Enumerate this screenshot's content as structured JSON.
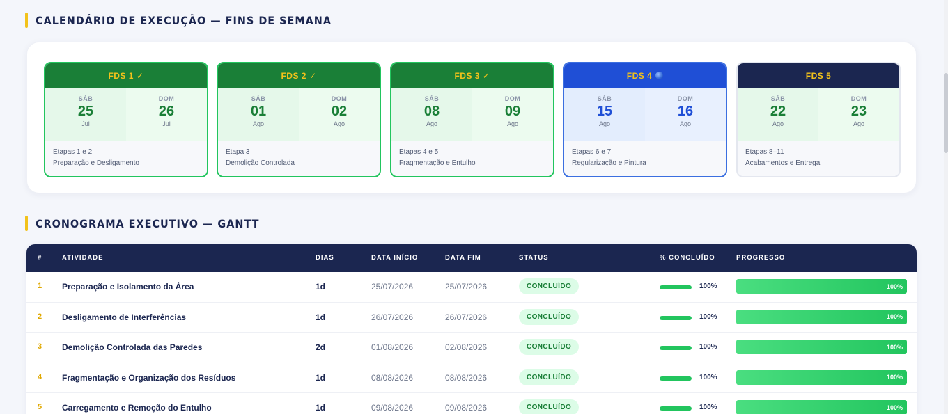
{
  "calendar_section": {
    "title": "CALENDÁRIO DE EXECUÇÃO — FINS DE SEMANA"
  },
  "weekends": [
    {
      "label": "FDS 1",
      "mark": "✓",
      "state": "done",
      "sat": {
        "name": "SÁB",
        "day": "25",
        "month": "Jul"
      },
      "sun": {
        "name": "DOM",
        "day": "26",
        "month": "Jul"
      },
      "steps": "Etapas 1 e 2",
      "desc": "Preparação e Desligamento"
    },
    {
      "label": "FDS 2",
      "mark": "✓",
      "state": "done",
      "sat": {
        "name": "SÁB",
        "day": "01",
        "month": "Ago"
      },
      "sun": {
        "name": "DOM",
        "day": "02",
        "month": "Ago"
      },
      "steps": "Etapa 3",
      "desc": "Demolição Controlada"
    },
    {
      "label": "FDS 3",
      "mark": "✓",
      "state": "done",
      "sat": {
        "name": "SÁB",
        "day": "08",
        "month": "Ago"
      },
      "sun": {
        "name": "DOM",
        "day": "09",
        "month": "Ago"
      },
      "steps": "Etapas 4 e 5",
      "desc": "Fragmentação e Entulho"
    },
    {
      "label": "FDS 4",
      "mark": "",
      "state": "current",
      "sat": {
        "name": "SÁB",
        "day": "15",
        "month": "Ago"
      },
      "sun": {
        "name": "DOM",
        "day": "16",
        "month": "Ago"
      },
      "steps": "Etapas 6 e 7",
      "desc": "Regularização e Pintura"
    },
    {
      "label": "FDS 5",
      "mark": "",
      "state": "upcoming",
      "sat": {
        "name": "SÁB",
        "day": "22",
        "month": "Ago"
      },
      "sun": {
        "name": "DOM",
        "day": "23",
        "month": "Ago"
      },
      "steps": "Etapas 8–11",
      "desc": "Acabamentos e Entrega"
    }
  ],
  "gantt_section": {
    "title": "CRONOGRAMA EXECUTIVO — GANTT"
  },
  "gantt": {
    "columns": {
      "num": "#",
      "activity": "ATIVIDADE",
      "days": "DIAS",
      "start": "DATA INÍCIO",
      "end": "DATA FIM",
      "status": "STATUS",
      "pct": "% CONCLUÍDO",
      "progress": "PROGRESSO"
    },
    "rows": [
      {
        "num": "1",
        "activity": "Preparação e Isolamento da Área",
        "days": "1d",
        "start": "25/07/2026",
        "end": "25/07/2026",
        "status": "CONCLUÍDO",
        "pct_label": "100%",
        "progress": 1.0
      },
      {
        "num": "2",
        "activity": "Desligamento de Interferências",
        "days": "1d",
        "start": "26/07/2026",
        "end": "26/07/2026",
        "status": "CONCLUÍDO",
        "pct_label": "100%",
        "progress": 1.0
      },
      {
        "num": "3",
        "activity": "Demolição Controlada das Paredes",
        "days": "2d",
        "start": "01/08/2026",
        "end": "02/08/2026",
        "status": "CONCLUÍDO",
        "pct_label": "100%",
        "progress": 1.0
      },
      {
        "num": "4",
        "activity": "Fragmentação e Organização dos Resíduos",
        "days": "1d",
        "start": "08/08/2026",
        "end": "08/08/2026",
        "status": "CONCLUÍDO",
        "pct_label": "100%",
        "progress": 1.0
      },
      {
        "num": "5",
        "activity": "Carregamento e Remoção do Entulho",
        "days": "1d",
        "start": "09/08/2026",
        "end": "09/08/2026",
        "status": "CONCLUÍDO",
        "pct_label": "100%",
        "progress": 1.0
      }
    ]
  },
  "colors": {
    "accent": "#f2c21b",
    "navy": "#1b2650",
    "done_green": "#1a7f37",
    "current_blue": "#1f4fd6",
    "progress_green": "#22c55e"
  }
}
